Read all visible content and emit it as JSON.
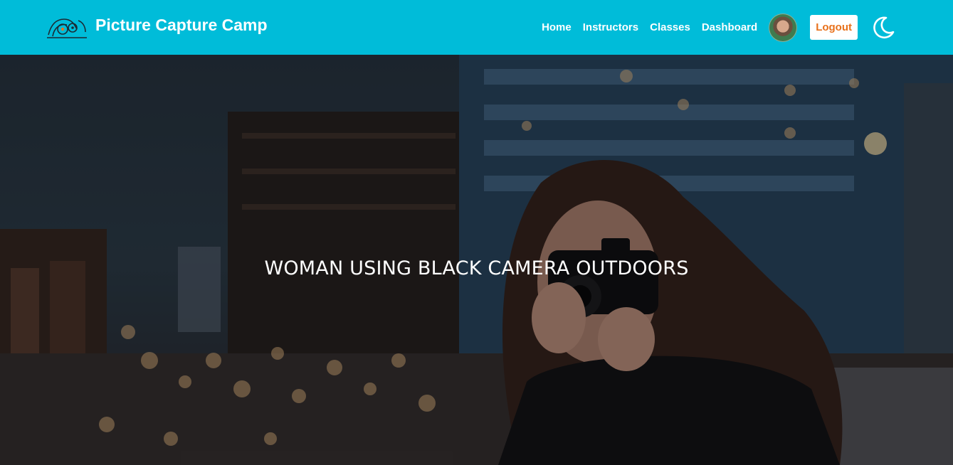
{
  "brand": {
    "name": "Picture Capture Camp",
    "logo_icon": "camera-logo-icon"
  },
  "nav": {
    "links": [
      {
        "label": "Home"
      },
      {
        "label": "Instructors"
      },
      {
        "label": "Classes"
      },
      {
        "label": "Dashboard"
      }
    ],
    "logout_label": "Logout",
    "theme_icon": "moon-icon"
  },
  "hero": {
    "title": "WOMAN USING BLACK CAMERA OUTDOORS"
  },
  "colors": {
    "navbar_bg": "#00bcd9",
    "logout_text": "#e8711b"
  }
}
